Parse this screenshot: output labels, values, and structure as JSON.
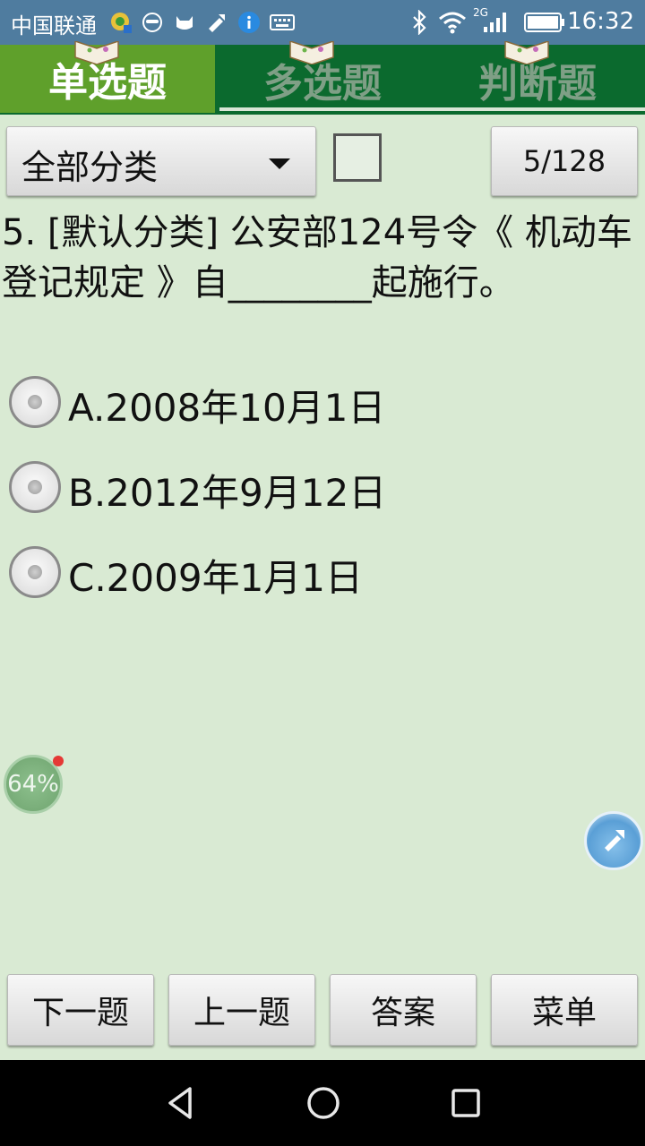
{
  "status_bar": {
    "carrier": "中国联通",
    "time": "16:32",
    "network": "2G",
    "icons": [
      "app-icon",
      "mask-icon",
      "cat-icon",
      "tool-icon",
      "info-icon",
      "keyboard-icon",
      "bluetooth-icon",
      "wifi-icon",
      "signal-icon",
      "battery-icon"
    ]
  },
  "tabs": [
    {
      "label": "单选题",
      "active": true
    },
    {
      "label": "多选题",
      "active": false
    },
    {
      "label": "判断题",
      "active": false
    }
  ],
  "controls": {
    "category": "全部分类",
    "checkbox_checked": false,
    "counter": "5/128"
  },
  "question": {
    "text": "5. [默认分类] 公安部124号令《 机动车登记规定 》自________起施行。"
  },
  "options": [
    {
      "label": "A.2008年10月1日",
      "selected": false
    },
    {
      "label": "B.2012年9月12日",
      "selected": false
    },
    {
      "label": "C.2009年1月1日",
      "selected": false
    }
  ],
  "floating": {
    "percent": "64%"
  },
  "bottom_buttons": {
    "next": "下一题",
    "prev": "上一题",
    "answer": "答案",
    "menu": "菜单"
  },
  "colors": {
    "status_bar": "#4f7c9f",
    "tab_bar": "#0b6a2e",
    "tab_active": "#5fa02b",
    "background": "#d9ead3"
  }
}
